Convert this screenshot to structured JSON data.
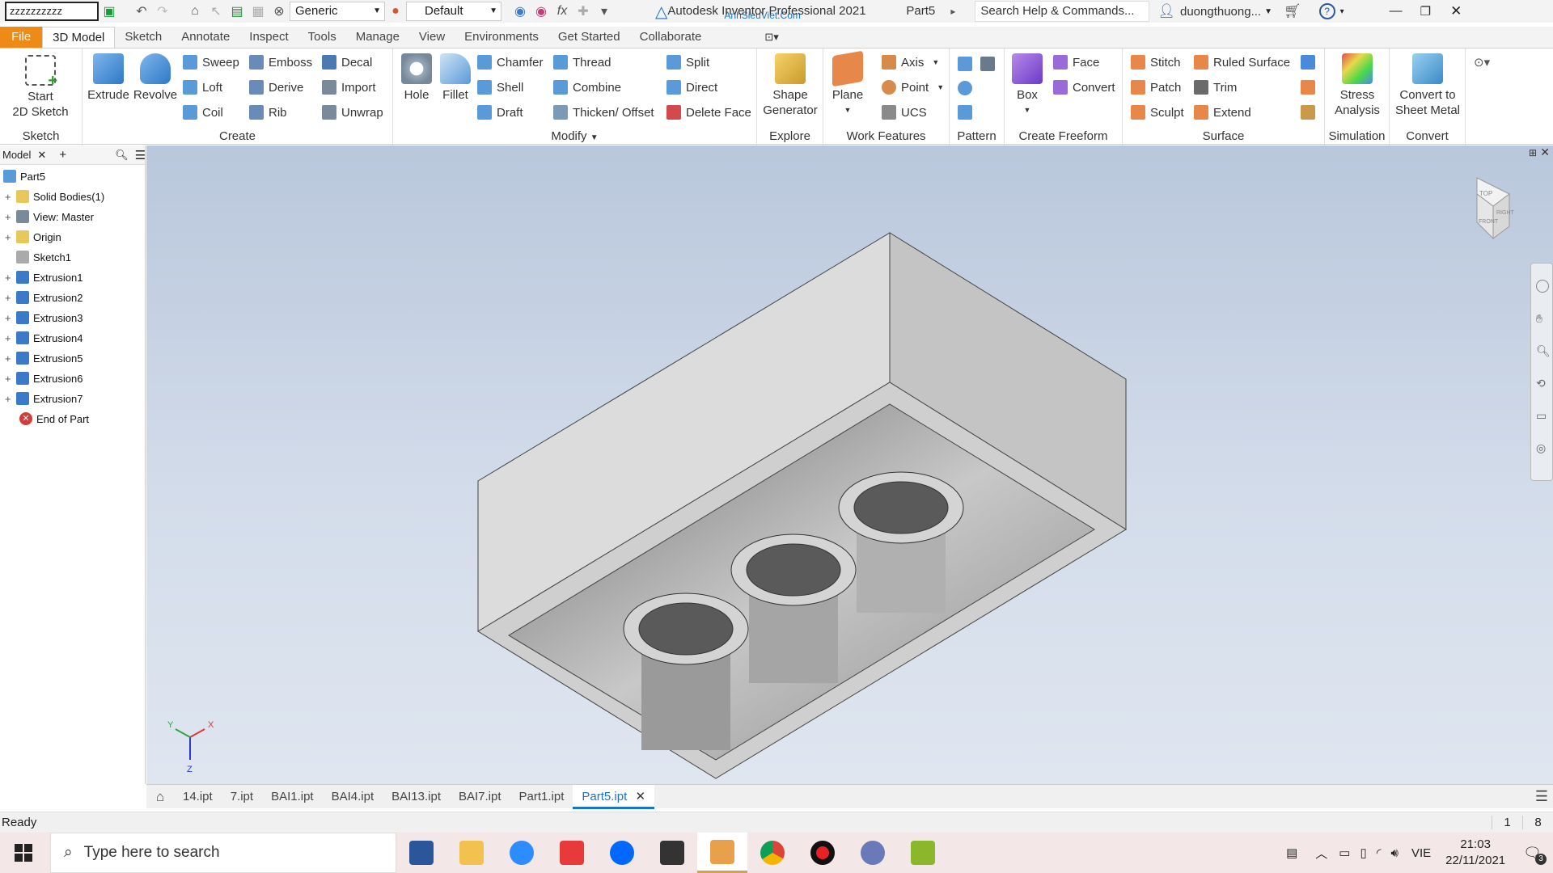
{
  "qat": {
    "sketch_name_input": "zzzzzzzzzz",
    "material": "Generic",
    "appearance": "Default",
    "app_title": "Autodesk Inventor Professional 2021",
    "doc_title": "Part5",
    "watermark": "AnhSieuViet.Com",
    "search_placeholder": "Search Help & Commands...",
    "user": "duongthuong..."
  },
  "tabs": [
    "File",
    "3D Model",
    "Sketch",
    "Annotate",
    "Inspect",
    "Tools",
    "Manage",
    "View",
    "Environments",
    "Get Started",
    "Collaborate"
  ],
  "ribbon": {
    "sketch": {
      "start_line1": "Start",
      "start_line2": "2D Sketch",
      "title": "Sketch"
    },
    "create": {
      "extrude": "Extrude",
      "revolve": "Revolve",
      "sweep": "Sweep",
      "loft": "Loft",
      "coil": "Coil",
      "emboss": "Emboss",
      "derive": "Derive",
      "rib": "Rib",
      "decal": "Decal",
      "import": "Import",
      "unwrap": "Unwrap",
      "title": "Create"
    },
    "modify": {
      "hole": "Hole",
      "fillet": "Fillet",
      "chamfer": "Chamfer",
      "shell": "Shell",
      "draft": "Draft",
      "thread": "Thread",
      "combine": "Combine",
      "thicken": "Thicken/ Offset",
      "split": "Split",
      "direct": "Direct",
      "delete_face": "Delete Face",
      "title": "Modify"
    },
    "explore": {
      "shape_line1": "Shape",
      "shape_line2": "Generator",
      "title": "Explore"
    },
    "work": {
      "plane": "Plane",
      "axis": "Axis",
      "point": "Point",
      "ucs": "UCS",
      "title": "Work Features"
    },
    "pattern": {
      "title": "Pattern"
    },
    "freeform": {
      "box": "Box",
      "face": "Face",
      "convert": "Convert",
      "title": "Create Freeform"
    },
    "surface": {
      "stitch": "Stitch",
      "patch": "Patch",
      "sculpt": "Sculpt",
      "ruled": "Ruled Surface",
      "trim": "Trim",
      "extend": "Extend",
      "title": "Surface"
    },
    "simulation": {
      "stress_line1": "Stress",
      "stress_line2": "Analysis",
      "title": "Simulation"
    },
    "convert": {
      "line1": "Convert to",
      "line2": "Sheet Metal",
      "title": "Convert"
    }
  },
  "browser": {
    "tab": "Model",
    "nodes": [
      "Part5",
      "Solid Bodies(1)",
      "View: Master",
      "Origin",
      "Sketch1",
      "Extrusion1",
      "Extrusion2",
      "Extrusion3",
      "Extrusion4",
      "Extrusion5",
      "Extrusion6",
      "Extrusion7",
      "End of Part"
    ]
  },
  "doc_tabs": [
    "14.ipt",
    "7.ipt",
    "BAI1.ipt",
    "BAI4.ipt",
    "BAI13.ipt",
    "BAI7.ipt",
    "Part1.ipt",
    "Part5.ipt"
  ],
  "status": {
    "text": "Ready",
    "n1": "1",
    "n2": "8"
  },
  "taskbar": {
    "search": "Type here to search",
    "lang": "VIE",
    "time": "21:03",
    "date": "22/11/2021",
    "notif": "3"
  },
  "viewcube": {
    "top": "TOP",
    "right": "RIGHT",
    "front": "FRONT"
  },
  "triad": {
    "x": "X",
    "y": "Y",
    "z": "Z"
  }
}
